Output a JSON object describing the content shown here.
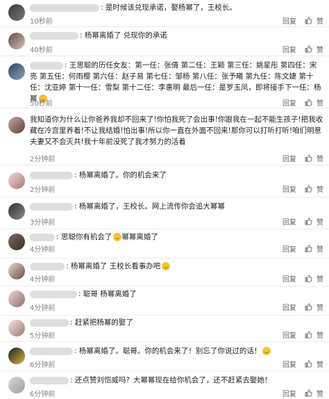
{
  "actions": {
    "reply": "回复",
    "like": "赞"
  },
  "comments": [
    {
      "text": "是时候该兑现承诺，娶杨幂了，王校长。",
      "time": "10秒前",
      "emoji": false
    },
    {
      "text": "杨幂离婚了 兑现你的承诺",
      "time": "40秒前",
      "emoji": false
    },
    {
      "text": "王思聪的历任女友：第一任：张倩 第二任：王颖 第三任：姚星彤 第四任：宋亮 第五任：何雨樱 第六任：赵子易 第七任：邹杨 第八任：张予曦 第九任：陈文婕 第十任：沈亚婷 第十一任：雪梨 第十二任：李惠明 最后一任：是罗玉凤，即将接手下一任：杨幂",
      "time": "50秒前",
      "emoji": true
    },
    {
      "text": "我知道你为什么让你爸养我却不回来了!你怕我死了会出事!你跟我在一起不能生孩子!把我收藏在冷宫里养着!不让我结婚!怕出事!所以你一直在外面不回来!那你可以打听打听!咱们明意夫妻又不会灭共!我十年前没死了我才努力的活着",
      "time": "2分钟前",
      "emoji": false
    },
    {
      "text": "杨幂离婚了。你的机会来了",
      "time": "2分钟前",
      "emoji": false
    },
    {
      "text": "杨幂离婚了，王校长。网上流传你会追大幂幂",
      "time": "3分钟前",
      "emoji": false
    },
    {
      "text": "思聪你有机会了",
      "text2": "幂幂离婚了",
      "time": "4分钟前",
      "emoji": true
    },
    {
      "text": "杨幂离婚了 王校长看事办吧",
      "time": "4分钟前",
      "emoji": true
    },
    {
      "text": "聪哥 杨幂离婚了",
      "time": "4分钟前",
      "emoji": false
    },
    {
      "text": "赶紧把杨幂的娶了",
      "time": "5分钟前",
      "emoji": false
    },
    {
      "text": "杨幂离婚了。聪哥。你的机会来了！别忘了你说过的话！",
      "time": "6分钟前",
      "emoji": true
    },
    {
      "text": "还点赞刘恺威吗？大幂幂现在给你机会了，还不赶紧去娶她！",
      "time": "6分钟前",
      "emoji": false
    }
  ]
}
